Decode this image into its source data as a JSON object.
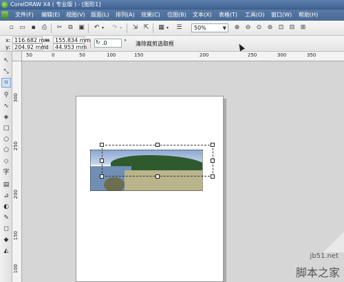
{
  "window": {
    "title": "CorelDRAW X4 ( 专业版 ) - [图形1]"
  },
  "menu": {
    "items": [
      "文件(F)",
      "编辑(E)",
      "视图(V)",
      "版面(L)",
      "排列(A)",
      "效果(C)",
      "位图(B)",
      "文本(X)",
      "表格(T)",
      "工具(O)",
      "窗口(W)",
      "帮助(H)"
    ]
  },
  "toolbar": {
    "zoom_level": "50%",
    "icons": [
      "new-icon",
      "open-icon",
      "save-icon",
      "print-icon",
      "cut-icon",
      "copy-icon",
      "paste-icon",
      "undo-icon",
      "redo-icon",
      "import-icon",
      "export-icon",
      "app-launcher-icon",
      "welcome-icon",
      "zoom-in-icon",
      "zoom-out-icon",
      "zoom-selected-icon",
      "zoom-all-icon",
      "zoom-page-icon",
      "zoom-width-icon",
      "zoom-height-icon"
    ]
  },
  "properties": {
    "x_label": "x:",
    "x_value": "116.682 mm",
    "y_label": "y:",
    "y_value": "204.92 mm",
    "width_value": "155.834 mm",
    "height_value": "44.953 mm",
    "rotation_value": ".0",
    "rotation_unit": "°",
    "clear_clip_label": "清除裁剪选取框"
  },
  "ruler": {
    "h_labels": [
      "50",
      "0",
      "50",
      "100",
      "150",
      "200",
      "250",
      "300",
      "350"
    ],
    "v_labels": [
      "300",
      "250",
      "200",
      "150",
      "100"
    ]
  },
  "toolbox": {
    "tools": [
      "pick-tool-icon",
      "shape-tool-icon",
      "crop-tool-icon",
      "zoom-tool-icon",
      "freehand-tool-icon",
      "smart-fill-icon",
      "rectangle-tool-icon",
      "ellipse-tool-icon",
      "polygon-tool-icon",
      "basic-shapes-icon",
      "text-tool-icon",
      "table-tool-icon",
      "dimension-tool-icon",
      "interactive-tool-icon",
      "eyedropper-tool-icon",
      "outline-tool-icon",
      "fill-tool-icon",
      "interactive-fill-icon"
    ]
  },
  "watermark": {
    "url": "jb51.net",
    "text": "脚本之家"
  }
}
